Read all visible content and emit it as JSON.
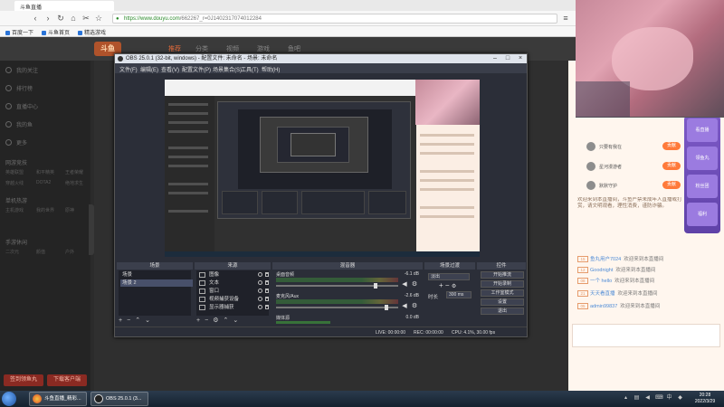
{
  "browser": {
    "tabs": [
      "斗鱼直播"
    ],
    "url_domain": "https://www.douyu.com",
    "url_path": "/662267_r=0J1402317074012284",
    "bookmarks": [
      "百度一下",
      "斗鱼首页",
      "精选游戏"
    ]
  },
  "douyu": {
    "logo": "斗鱼",
    "nav": [
      "推荐",
      "分类",
      "视频",
      "游戏",
      "鱼吧"
    ],
    "sidebar": {
      "main_items": [
        "我的关注",
        "排行榜",
        "直播中心",
        "我的鱼",
        "更多"
      ],
      "section_labels": [
        "网游竞技",
        "单机热游",
        "手游休闲"
      ],
      "grid_items": [
        "英雄联盟",
        "和平精英",
        "王者荣耀",
        "穿越火线",
        "DOTA2",
        "绝地求生",
        "主机游戏",
        "我的世界",
        "原神",
        "二次元",
        "颜值",
        "户外"
      ],
      "buttons": [
        "签到领鱼丸",
        "下载客户端"
      ]
    },
    "chat": {
      "ranks": [
        {
          "name": "只要有我在",
          "badge": "贡献"
        },
        {
          "name": "星河漫游者",
          "badge": "贡献"
        },
        {
          "name": "默默守护",
          "badge": "贡献"
        }
      ],
      "top_message": "欢迎来到本直播间，斗鱼严禁未成年人直播或打赏，请文明观看，理性消费，谨防诈骗。",
      "lines": [
        {
          "lv": "15",
          "user": "鱼丸用户7024",
          "text": "欢迎来到本直播间"
        },
        {
          "lv": "12",
          "user": "Goodnight",
          "text": "欢迎来到本直播间"
        },
        {
          "lv": "08",
          "user": "一个 hello",
          "text": "欢迎来到本直播间"
        },
        {
          "lv": "21",
          "user": "天天看直播",
          "text": "欢迎来到本直播间"
        },
        {
          "lv": "05",
          "user": "admin99837",
          "text": "欢迎来到本直播间"
        }
      ],
      "promos": [
        "看直播",
        "领鱼丸",
        "粉丝团",
        "福利"
      ]
    }
  },
  "obs": {
    "title": "OBS 25.0.1 (32-bit, windows) - 配置文件: 未命名 - 场景: 未命名",
    "menu": [
      "文件(F)",
      "编辑(E)",
      "查看(V)",
      "配置文件(P)",
      "场景集合(S)",
      "工具(T)",
      "帮助(H)"
    ],
    "docks": {
      "scenes_title": "场景",
      "sources_title": "来源",
      "mixer_title": "混音器",
      "transitions_title": "场景过渡",
      "controls_title": "控件"
    },
    "scenes": [
      "场景",
      "场景 2"
    ],
    "sources": [
      "图像",
      "文本",
      "窗口",
      "视频捕获设备",
      "显示器捕获"
    ],
    "mixer": [
      {
        "name": "桌面音频",
        "db": "-6.1 dB"
      },
      {
        "name": "麦克风/Aux",
        "db": "-2.6 dB"
      },
      {
        "name": "媒体源",
        "db": "0.0 dB"
      }
    ],
    "transition": {
      "select": "淡出",
      "duration_label": "时长",
      "duration": "300 ms"
    },
    "controls": [
      "开始推流",
      "开始录制",
      "工作室模式",
      "设置",
      "退出"
    ],
    "status": {
      "live": "LIVE: 00:00:00",
      "rec": "REC: 00:00:00",
      "cpu": "CPU: 4.1%, 30.00 fps"
    }
  },
  "taskbar": {
    "buttons": [
      "斗鱼直播_精彩...",
      "OBS 25.0.1 (3..."
    ],
    "time": "20:28",
    "date": "2022/3/29"
  }
}
